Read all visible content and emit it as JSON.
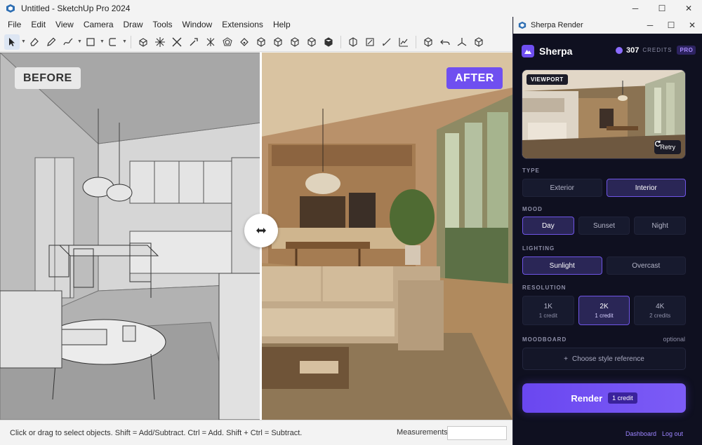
{
  "sketchup": {
    "window_title": "Untitled - SketchUp Pro 2024",
    "menus": [
      "File",
      "Edit",
      "View",
      "Camera",
      "Draw",
      "Tools",
      "Window",
      "Extensions",
      "Help"
    ],
    "labels": {
      "before": "BEFORE",
      "after": "AFTER"
    },
    "status_hint": "Click or drag to select objects. Shift = Add/Subtract. Ctrl = Add. Shift + Ctrl = Subtract.",
    "measurements_label": "Measurements",
    "measurements_value": ""
  },
  "sherpa": {
    "window_title": "Sherpa Render",
    "brand": "Sherpa",
    "credits": "307",
    "credits_label": "CREDITS",
    "plan": "PRO",
    "preview_tag": "VIEWPORT",
    "retry_label": "Retry",
    "type": {
      "title": "TYPE",
      "options": [
        "Exterior",
        "Interior"
      ],
      "selected": "Interior"
    },
    "mood": {
      "title": "MOOD",
      "options": [
        "Day",
        "Sunset",
        "Night"
      ],
      "selected": "Day"
    },
    "lighting": {
      "title": "LIGHTING",
      "options": [
        "Sunlight",
        "Overcast"
      ],
      "selected": "Sunlight"
    },
    "resolution": {
      "title": "RESOLUTION",
      "options": [
        {
          "label": "1K",
          "cost": "1 credit"
        },
        {
          "label": "2K",
          "cost": "1 credit"
        },
        {
          "label": "4K",
          "cost": "2 credits"
        }
      ],
      "selected": "2K"
    },
    "moodboard": {
      "title": "MOODBOARD",
      "optional": "optional",
      "button": "Choose style reference"
    },
    "render": {
      "label": "Render",
      "cost": "1 credit"
    },
    "footer": {
      "dashboard": "Dashboard",
      "logout": "Log out"
    }
  },
  "colors": {
    "accent": "#6f4ff0",
    "panel_bg": "#0f1020",
    "option_selected_bg": "#2a2656"
  }
}
